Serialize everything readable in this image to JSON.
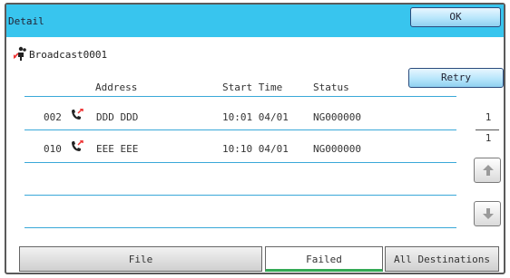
{
  "window": {
    "title": "Detail",
    "ok_label": "OK"
  },
  "job": {
    "name": "Broadcast0001",
    "icon": "broadcast-icon"
  },
  "actions": {
    "retry_label": "Retry"
  },
  "table": {
    "headers": {
      "address": "Address",
      "start_time": "Start Time",
      "status": "Status"
    },
    "rows": [
      {
        "number": "002",
        "icon": "fax-phone-icon",
        "address": "DDD DDD",
        "start_time": "10:01 04/01",
        "status": "NG000000"
      },
      {
        "number": "010",
        "icon": "fax-phone-icon",
        "address": "EEE EEE",
        "start_time": "10:10 04/01",
        "status": "NG000000"
      }
    ]
  },
  "pager": {
    "current": "1",
    "total": "1"
  },
  "tabs": [
    {
      "label": "File",
      "active": false
    },
    {
      "label": "Failed",
      "active": true
    },
    {
      "label": "All Destinations",
      "active": false
    }
  ],
  "colors": {
    "titlebar": "#38c5ee",
    "button": "#b8e6fb",
    "divider": "#39a8d8",
    "active_tab_underline": "#33aa55"
  }
}
